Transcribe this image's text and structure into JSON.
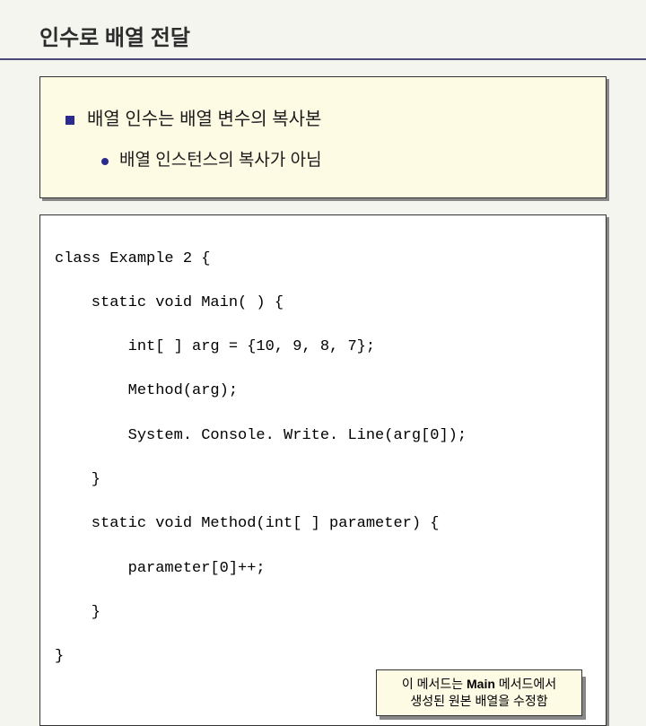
{
  "title": "인수로 배열 전달",
  "bullets": {
    "main": "배열 인수는 배열 변수의 복사본",
    "sub": "배열 인스턴스의 복사가 아님"
  },
  "code": {
    "lines": [
      "class Example 2 {",
      "    static void Main( ) {",
      "        int[ ] arg = {10, 9, 8, 7};",
      "        Method(arg);",
      "        System. Console. Write. Line(arg[0]);",
      "    }",
      "    static void Method(int[ ] parameter) {",
      "        parameter[0]++;",
      "    }",
      "}"
    ]
  },
  "callout": {
    "line1_pre": "이 메서드는 ",
    "line1_bold": "Main",
    "line1_post": " 메서드에서",
    "line2": "생성된 원본 배열을 수정함"
  }
}
